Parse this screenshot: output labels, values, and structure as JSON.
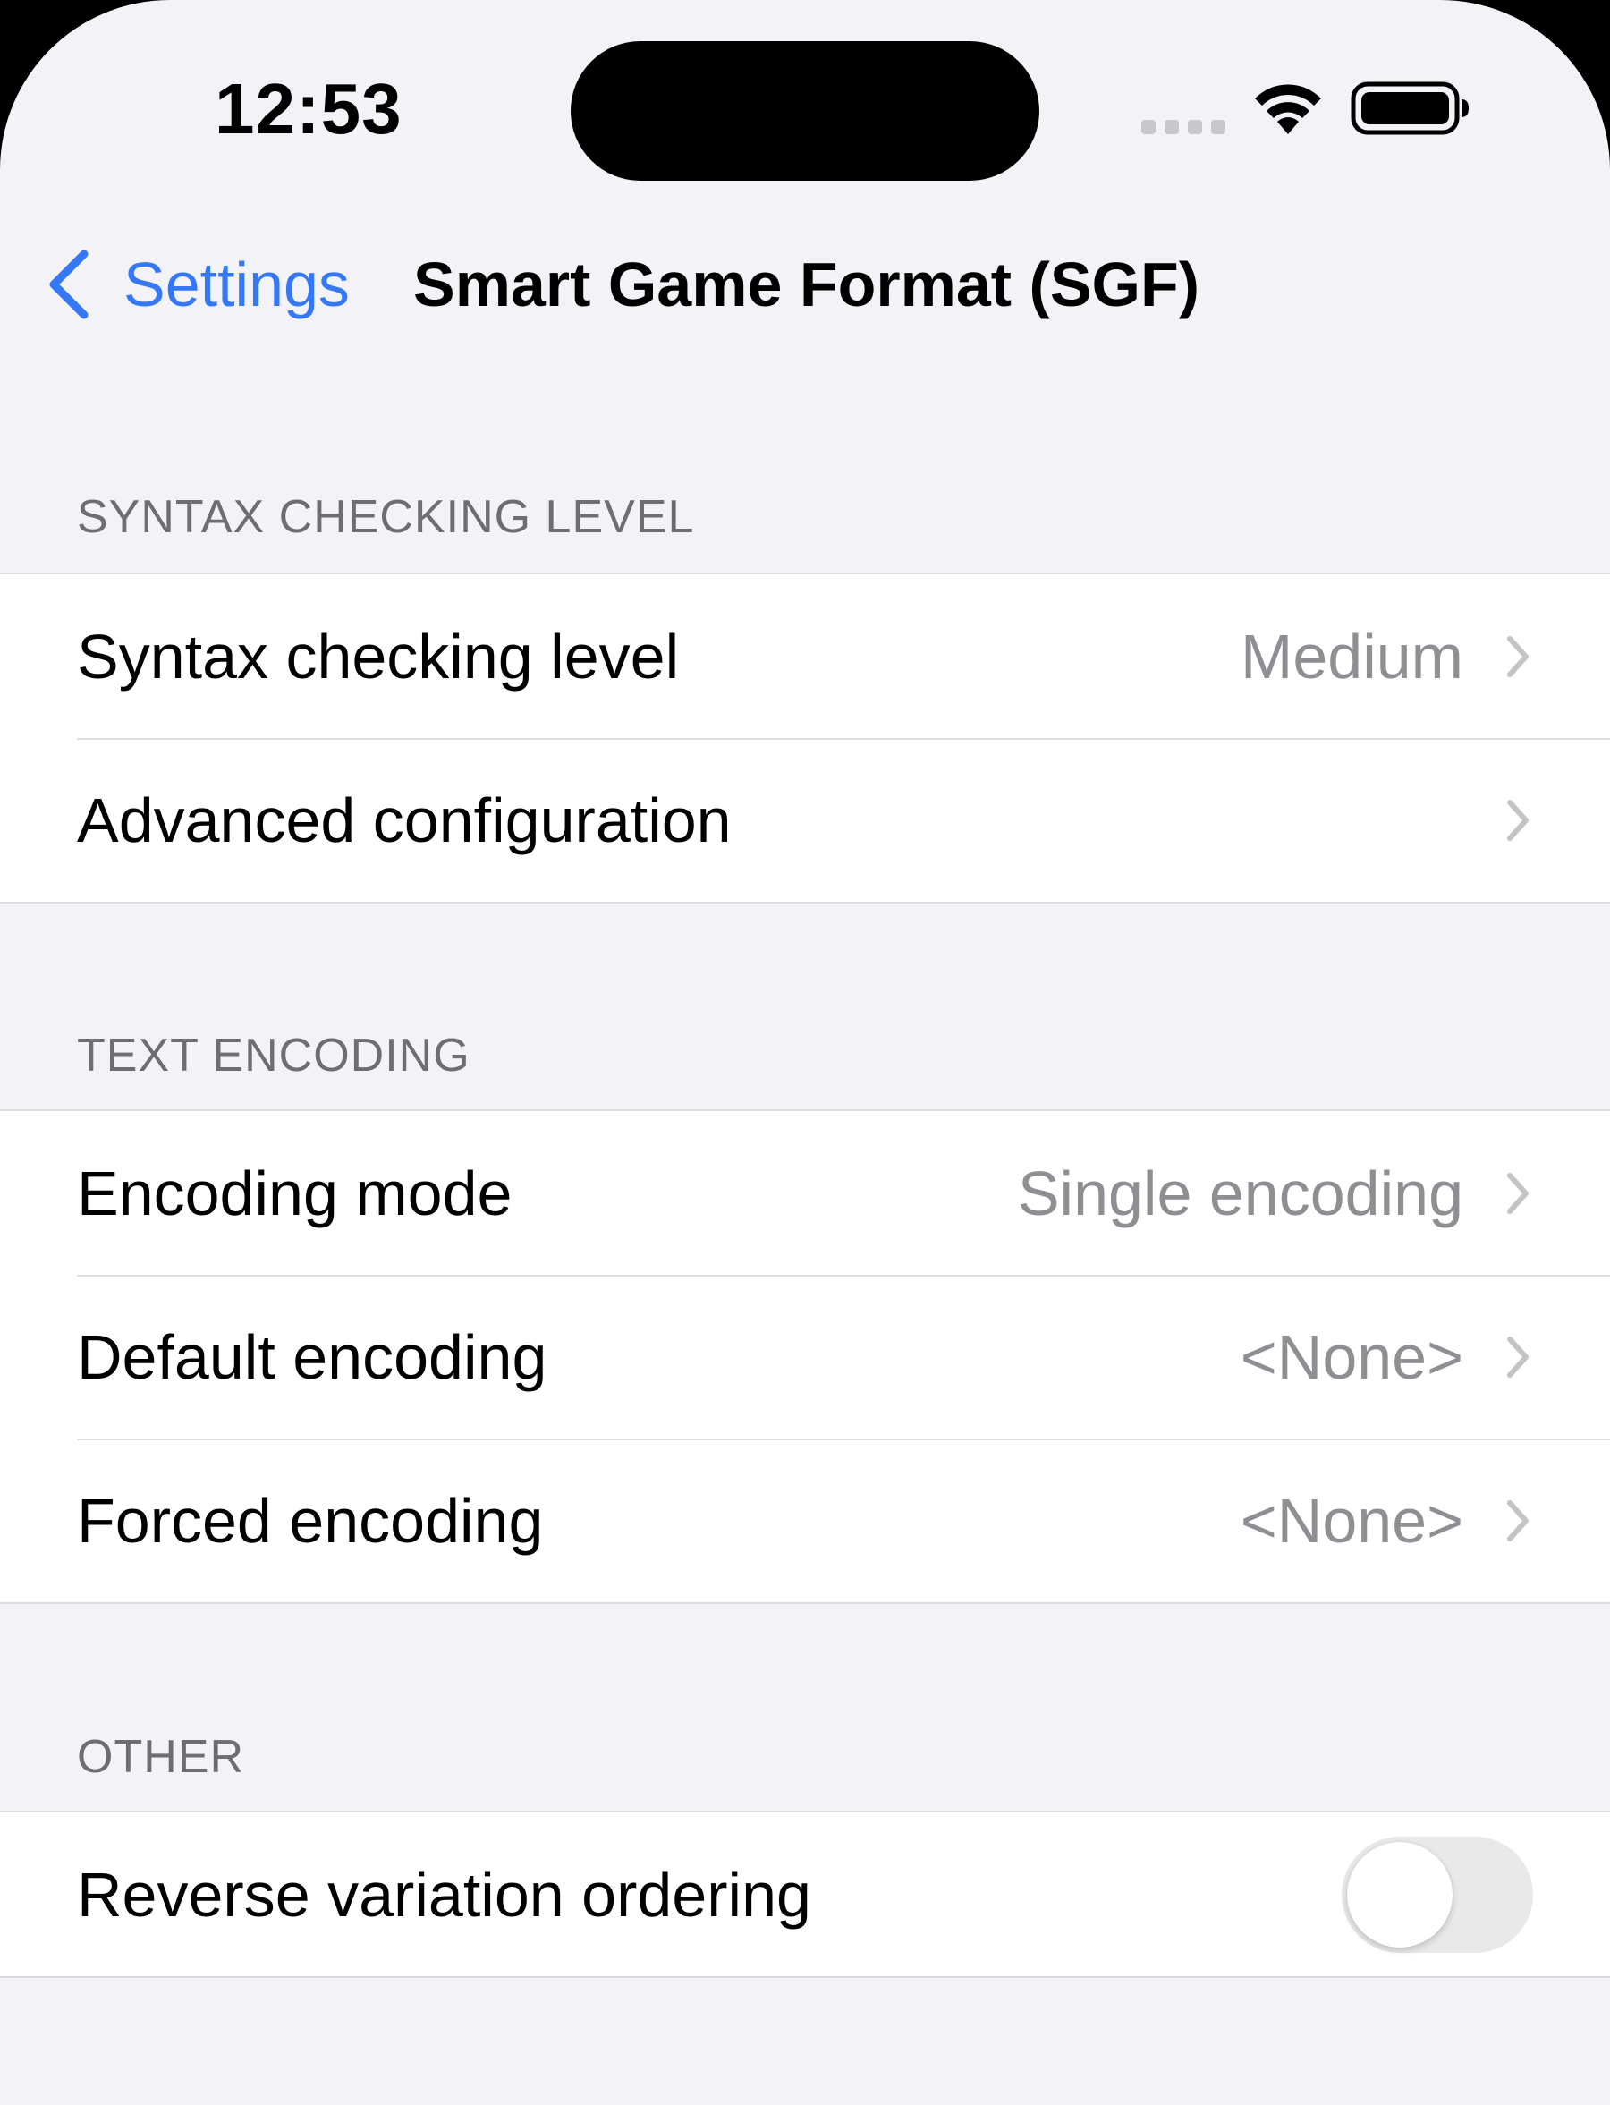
{
  "status_bar": {
    "time": "12:53",
    "signal_icon": "cellular-signal-dots",
    "wifi_icon": "wifi-icon",
    "battery_icon": "battery-icon"
  },
  "nav": {
    "back_label": "Settings",
    "title": "Smart Game Format (SGF)"
  },
  "sections": [
    {
      "header": "SYNTAX CHECKING LEVEL",
      "rows": [
        {
          "label": "Syntax checking level",
          "value": "Medium"
        },
        {
          "label": "Advanced configuration",
          "value": ""
        }
      ]
    },
    {
      "header": "TEXT ENCODING",
      "rows": [
        {
          "label": "Encoding mode",
          "value": "Single encoding"
        },
        {
          "label": "Default encoding",
          "value": "<None>"
        },
        {
          "label": "Forced encoding",
          "value": "<None>"
        }
      ]
    },
    {
      "header": "OTHER",
      "rows": [
        {
          "label": "Reverse variation ordering",
          "toggle_on": false
        }
      ]
    }
  ],
  "colors": {
    "accent": "#3478f6",
    "background": "#f2f2f7",
    "cell": "#ffffff",
    "secondary_text": "#8e8e93",
    "section_header": "#6d6d72",
    "separator": "#dcdce0",
    "toggle_off": "#e9e9ea"
  }
}
